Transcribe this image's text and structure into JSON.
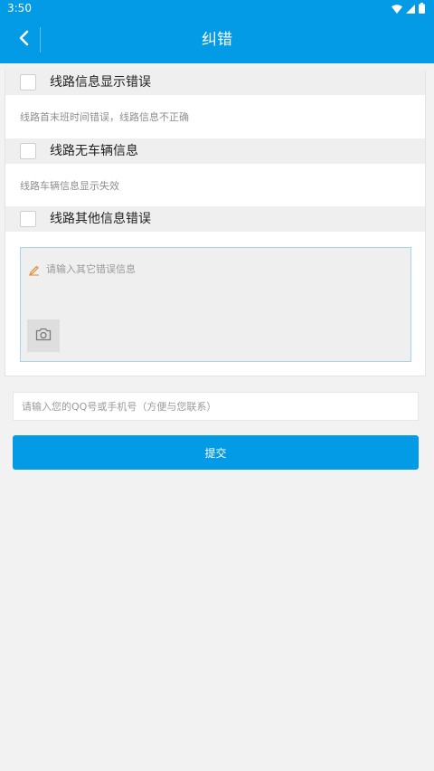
{
  "status_bar": {
    "time": "3:50",
    "icons": [
      "wifi-icon",
      "signal-icon",
      "battery-icon"
    ]
  },
  "nav": {
    "title": "纠错",
    "back_icon": "chevron-left-icon"
  },
  "colors": {
    "primary": "#039be5",
    "background": "#f2f2f2",
    "option_row_bg": "#efefef"
  },
  "options": [
    {
      "label": "线路信息显示错误",
      "description": "线路首末班时间错误，线路信息不正确",
      "checked": false
    },
    {
      "label": "线路无车辆信息",
      "description": "线路车辆信息显示失效",
      "checked": false
    },
    {
      "label": "线路其他信息错误",
      "checked": false
    }
  ],
  "other_error": {
    "placeholder": "请输入其它错误信息",
    "value": "",
    "pencil_icon": "pencil-icon",
    "camera_icon": "camera-icon"
  },
  "contact": {
    "placeholder": "请输入您的QQ号或手机号（方便与您联系）",
    "value": ""
  },
  "submit": {
    "label": "提交"
  }
}
